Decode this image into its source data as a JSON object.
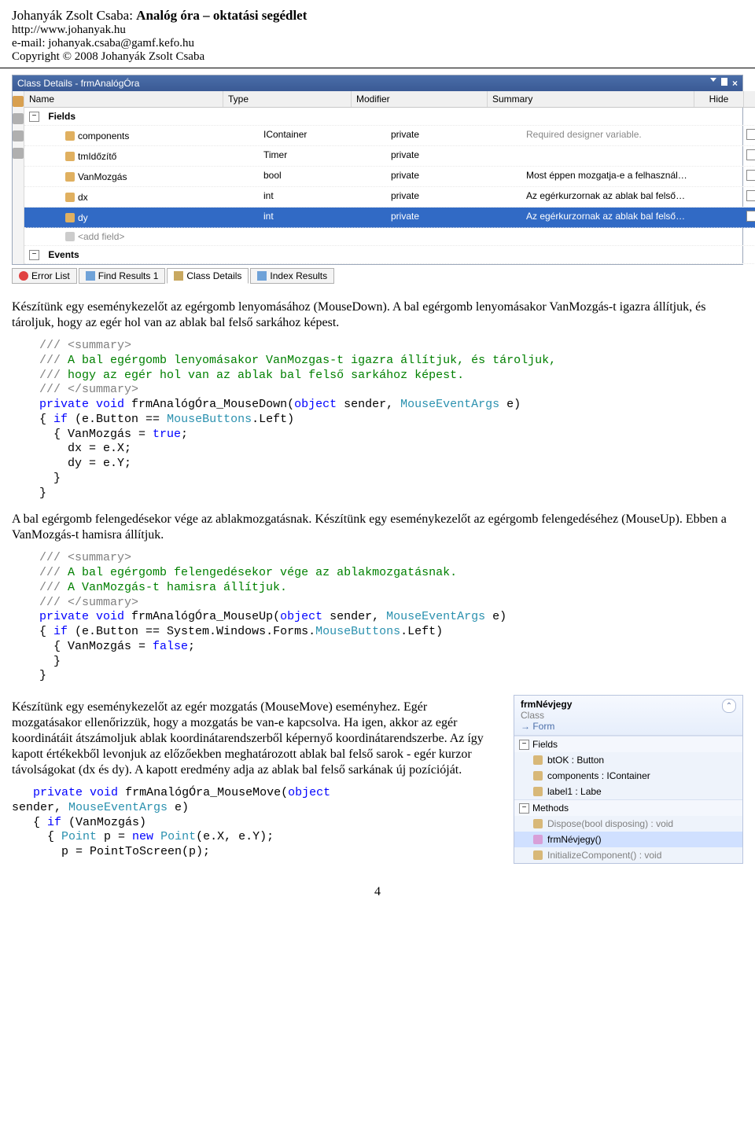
{
  "header": {
    "author": "Johanyák Zsolt Csaba:",
    "title": "Analóg óra – oktatási segédlet",
    "url": "http://www.johanyak.hu",
    "email": "e-mail: johanyak.csaba@gamf.kefo.hu",
    "copyright": "Copyright © 2008 Johanyák Zsolt Csaba"
  },
  "classDetails": {
    "title": "Class Details - frmAnalógÓra",
    "columns": {
      "name": "Name",
      "type": "Type",
      "modifier": "Modifier",
      "summary": "Summary",
      "hide": "Hide"
    },
    "fieldsGroup": "Fields",
    "addField": "<add field>",
    "eventsGroup": "Events",
    "rows": [
      {
        "name": "components",
        "type": "IContainer",
        "modifier": "private",
        "summary": "Required designer variable."
      },
      {
        "name": "tmIdőzítő",
        "type": "Timer",
        "modifier": "private",
        "summary": ""
      },
      {
        "name": "VanMozgás",
        "type": "bool",
        "modifier": "private",
        "summary": "Most éppen mozgatja-e a felhasznál…"
      },
      {
        "name": "dx",
        "type": "int",
        "modifier": "private",
        "summary": "Az egérkurzornak az ablak bal felső…"
      },
      {
        "name": "dy",
        "type": "int",
        "modifier": "private",
        "summary": "Az egérkurzornak az ablak bal felső…"
      }
    ]
  },
  "tabs": {
    "errorList": "Error List",
    "findResults": "Find Results 1",
    "classDetails": "Class Details",
    "indexResults": "Index Results"
  },
  "paras": {
    "p1": "Készítünk egy eseménykezelőt az egérgomb lenyomásához (MouseDown). A bal egérgomb lenyomásakor VanMozgás-t igazra állítjuk, és tároljuk, hogy az egér hol van az ablak bal felső sarkához képest.",
    "p2": "A bal egérgomb felengedésekor vége az ablakmozgatásnak. Készítünk egy eseménykezelőt az egérgomb felengedéséhez (MouseUp). Ebben a VanMozgás-t hamisra állítjuk.",
    "p3": "Készítünk egy eseménykezelőt az egér mozgatás (MouseMove) eseményhez. Egér mozgatásakor ellenőrizzük, hogy a mozgatás be van-e kapcsolva. Ha igen, akkor az egér koordinátáit átszámoljuk ablak koordinátarendszerből képernyő koordinátarendszerbe. Az így kapott értékekből levonjuk az előzőekben meghatározott ablak bal felső sarok - egér kurzor távolságokat (dx és dy). A kapott eredmény adja az ablak bal felső sarkának új pozícióját."
  },
  "nvPanel": {
    "title": "frmNévjegy",
    "class": "Class",
    "form": "Form",
    "fields": "Fields",
    "methods": "Methods",
    "items": {
      "btOK": "btOK : Button",
      "components": "components : IContainer",
      "label1": "label1 : Labe",
      "dispose": "Dispose(bool disposing) : void",
      "ctor": "frmNévjegy()",
      "init": "InitializeComponent() : void"
    }
  },
  "pageNumber": "4"
}
